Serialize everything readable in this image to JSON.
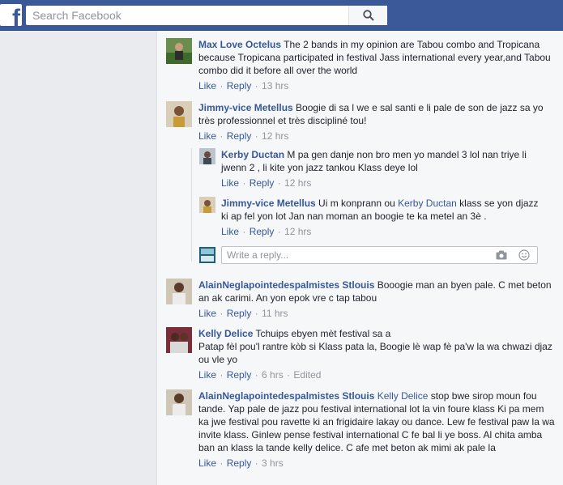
{
  "topbar": {
    "logo": "f",
    "search_placeholder": "Search Facebook"
  },
  "comments": [
    {
      "name": "Max Love Octelus",
      "text": " The 2 bands in my opinion are Tabou combo and Tropicana because Tropicana participated in festival Jass international every year,and Tabou combo did it before all over the world",
      "like": "Like",
      "reply": "Reply",
      "time": "13 hrs"
    },
    {
      "name": "Jimmy-vice Metellus",
      "text": " Boogie di sa l we e sal santi e li pale de son de jazz sa yo très professionnel et très discipliné tou!",
      "like": "Like",
      "reply": "Reply",
      "time": "12 hrs"
    },
    {
      "name": "AlainNeglapointedespalmistes Stlouis",
      "text": " Booogie man an byen pale. C met beton an ak carimi. An yon epok vre c tap tabou",
      "like": "Like",
      "reply": "Reply",
      "time": "11 hrs"
    },
    {
      "name": "Kelly Delice",
      "text": " Tchuips ebyen mèt festival sa a",
      "text2": "Patap fèl pou'l rantre kòb si Klass pata la, Boogie lè wap fè pa'w la wa chwazi djaz ou vle yo",
      "like": "Like",
      "reply": "Reply",
      "time": "6 hrs",
      "edited": "Edited"
    },
    {
      "name": "AlainNeglapointedespalmistes Stlouis",
      "mention": "Kelly Delice",
      "text": " stop bwe sirop moun fou tande. Yap pale de jazz pou festival international lot la vin foure klass Ki pa mem ka jwe festival pou ravette ki an frigidaire lakay ou dance. Lew fe festival paw la wa invite klass. Ginlew pense festival international C fe bal li ye boss. Al chita amba ban an klass la tande kelly delice. C afe met beton ak mimi ak pale la",
      "like": "Like",
      "reply": "Reply",
      "time": "3 hrs"
    }
  ],
  "replies": [
    {
      "name": "Kerby Ductan",
      "text": " M pa gen danje non bro men yo mandel 3 lol nan triye li jwenn 2 , li kite yon jazz tankou Klass deye lol",
      "like": "Like",
      "reply": "Reply",
      "time": "12 hrs"
    },
    {
      "name": "Jimmy-vice Metellus",
      "text_pre": " Ui m konprann ou ",
      "mention": "Kerby Ductan",
      "text": " klass se yon djazz ki ap fel yon lot Jan nan moman an boogie te ka metel an 3è .",
      "like": "Like",
      "reply": "Reply",
      "time": "12 hrs"
    }
  ],
  "reply_box": {
    "placeholder": "Write a reply..."
  },
  "icons": {
    "search": "search-icon",
    "camera": "camera-icon",
    "emoji": "emoji-icon"
  },
  "colors": {
    "brand": "#3b5998",
    "link": "#365899",
    "meta": "#90949c"
  }
}
